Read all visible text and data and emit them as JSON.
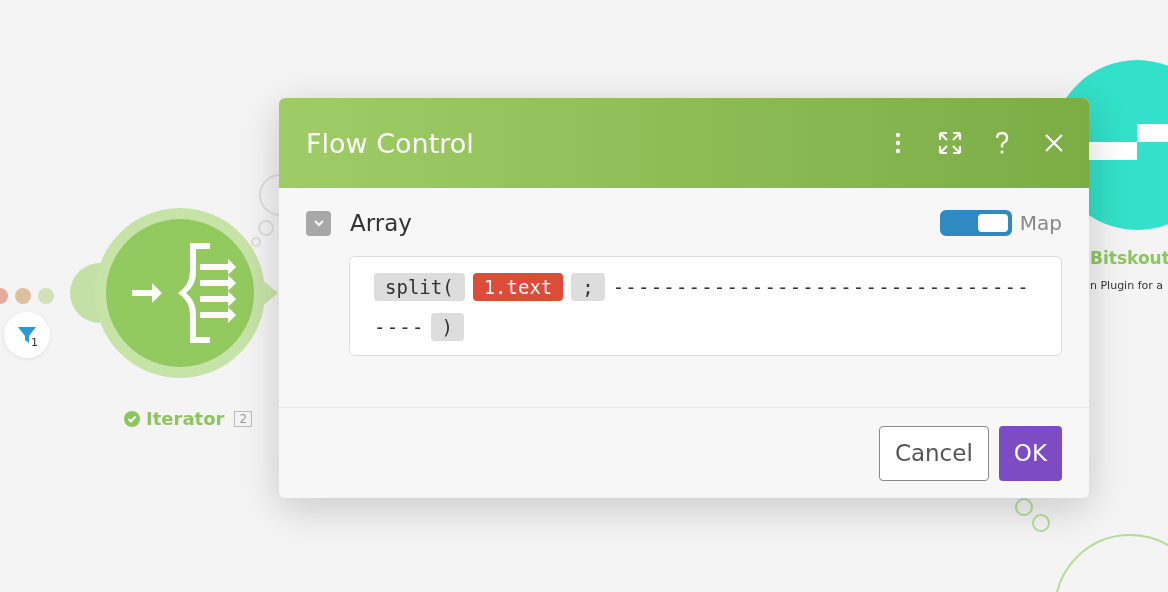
{
  "canvas": {
    "filter": {
      "count": "1"
    },
    "modules": [
      {
        "kind": "iterator",
        "name": "Iterator",
        "number": "2",
        "ok": true
      },
      {
        "kind": "app",
        "name": "Bitskout",
        "subtitle": "n Plugin for a"
      }
    ]
  },
  "dialog": {
    "title": "Flow Control",
    "field": {
      "label": "Array",
      "expanded": true,
      "map": {
        "label": "Map",
        "on": true
      },
      "tokens": [
        {
          "kind": "function",
          "text": "split("
        },
        {
          "kind": "variable",
          "text": "1.text"
        },
        {
          "kind": "function",
          "text": ";"
        },
        {
          "kind": "literal",
          "text": "---------------------------------"
        },
        {
          "kind": "literal",
          "text": "----"
        },
        {
          "kind": "function",
          "text": ")"
        }
      ]
    },
    "buttons": [
      {
        "label": "Cancel",
        "kind": "secondary"
      },
      {
        "label": "OK",
        "kind": "primary"
      }
    ]
  }
}
